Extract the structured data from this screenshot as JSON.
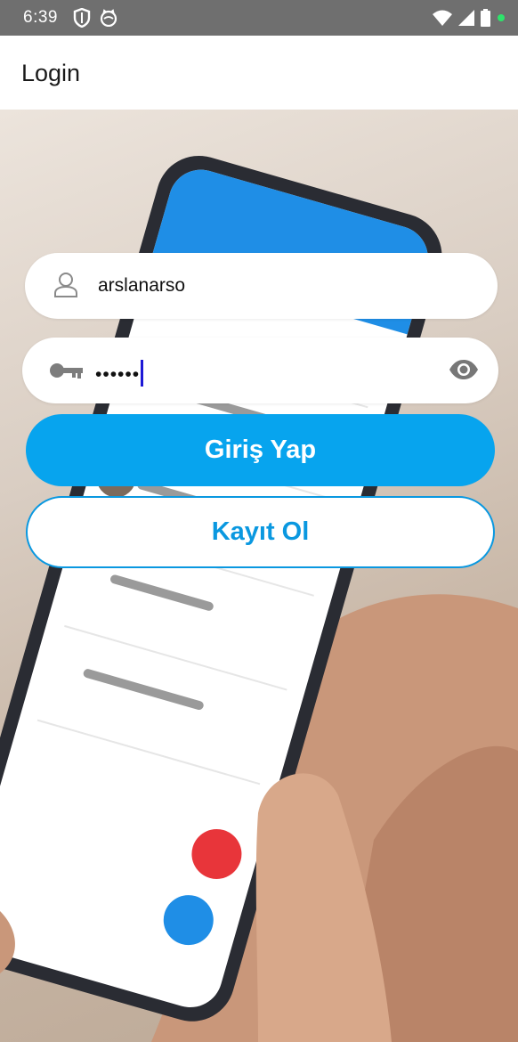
{
  "status_bar": {
    "time": "6:39",
    "left_icons": [
      "shield-icon",
      "cat-icon"
    ],
    "right_icons": [
      "wifi-icon",
      "signal-icon",
      "battery-icon",
      "dot-icon"
    ]
  },
  "app_bar": {
    "title": "Login"
  },
  "form": {
    "username": {
      "value": "arslanarso",
      "icon": "person-icon"
    },
    "password": {
      "value": "••••••",
      "icon": "key-icon",
      "toggle_icon": "eye-icon"
    },
    "login_label": "Giriş Yap",
    "register_label": "Kayıt Ol"
  },
  "colors": {
    "primary": "#07a4ee",
    "status_bar": "#6f6f6f",
    "caret": "#1d18d6"
  }
}
